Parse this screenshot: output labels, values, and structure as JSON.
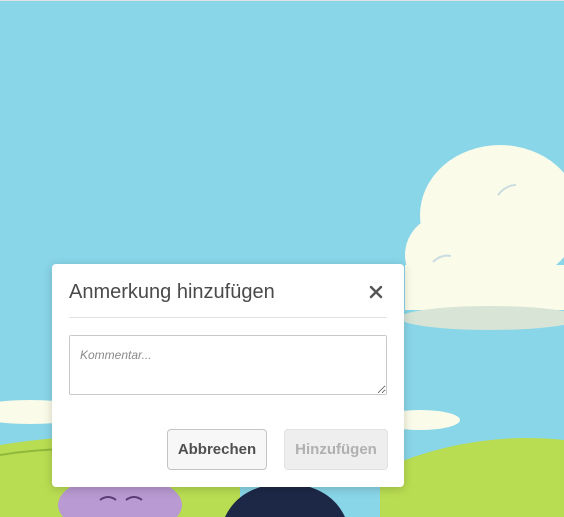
{
  "background": {
    "description_icon": "cartoon-landscape-image"
  },
  "dialog": {
    "title": "Anmerkung hinzufügen",
    "close_icon": "close-icon",
    "comment_placeholder": "Kommentar...",
    "comment_value": "",
    "cancel_label": "Abbrechen",
    "add_label": "Hinzufügen",
    "add_enabled": false
  },
  "colors": {
    "sky": "#89d6e9",
    "cloud": "#fbfbe9",
    "grass": "#b9dd52",
    "dialog_bg": "#ffffff"
  }
}
